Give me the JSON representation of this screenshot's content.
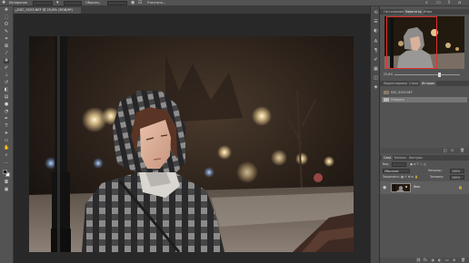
{
  "options_bar": {
    "menu_label": "Испарение",
    "sample_label": "Образец",
    "refine_label": "Уточнить...",
    "icons": [
      "spot-healing-icon",
      "brush-size-icon",
      "mode-icon",
      "pressure-icon",
      "sample-all-icon",
      "home-icon",
      "search-icon",
      "workspace-icon",
      "share-icon"
    ]
  },
  "document_tab": {
    "title": "DSC_9253.NEF @ 25,8% (RGB/8*)",
    "close_glyph": "×"
  },
  "toolbar": {
    "tools": [
      "move-icon",
      "marquee-icon",
      "lasso-icon",
      "quick-select-icon",
      "crop-icon",
      "frame-icon",
      "eyedropper-icon",
      "healing-icon",
      "brush-icon",
      "clone-stamp-icon",
      "history-brush-icon",
      "eraser-icon",
      "gradient-icon",
      "blur-icon",
      "dodge-icon",
      "pen-icon",
      "type-icon",
      "path-select-icon",
      "rectangle-icon",
      "hand-icon",
      "zoom-icon",
      "edit-toolbar-icon"
    ],
    "foreground_color": "#1a1a1a",
    "background_color": "#f2f2f2"
  },
  "navigator_panel": {
    "tabs": [
      "Гистограмма",
      "Навигатор",
      "Инфо"
    ],
    "active_tab": "Навигатор",
    "zoom": "25,8%"
  },
  "history_panel": {
    "tabs": [
      "Корректировки",
      "Стили",
      "История"
    ],
    "active_tab": "История",
    "items": [
      {
        "label": "DSC_9253.NEF",
        "selected": false
      },
      {
        "label": "Открыть",
        "selected": true
      }
    ]
  },
  "layers_panel": {
    "tabs": [
      "Слои",
      "Каналы",
      "Контуры"
    ],
    "active_tab": "Слои",
    "kind_label": "Вид",
    "blend_mode": "Обычные",
    "opacity_label": "Непрозр.:",
    "opacity_value": "100%",
    "lock_label": "Закрепить:",
    "fill_label": "Заливка:",
    "fill_value": "100%",
    "layers": [
      {
        "name": "Фон",
        "visible": true,
        "locked": true
      }
    ]
  },
  "colors": {
    "app_bg": "#282828",
    "panel_bg": "#535353",
    "selection_red": "#e03030"
  }
}
